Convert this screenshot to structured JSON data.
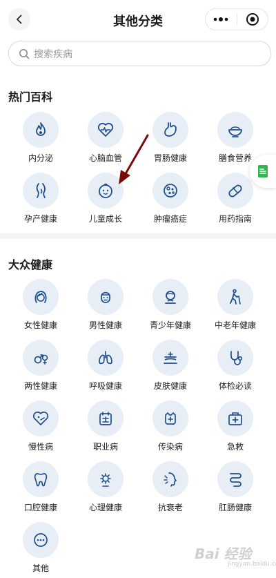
{
  "header": {
    "title": "其他分类",
    "back_icon": "chevron-left-icon",
    "more_icon": "more-dots-icon",
    "close_icon": "target-circle-icon"
  },
  "search": {
    "placeholder": "搜索疾病",
    "icon": "search-icon"
  },
  "sections": [
    {
      "title": "热门百科",
      "items": [
        {
          "label": "内分泌",
          "icon": "flame-icon"
        },
        {
          "label": "心脑血管",
          "icon": "heart-pulse-icon"
        },
        {
          "label": "胃肠健康",
          "icon": "stomach-icon"
        },
        {
          "label": "膳食营养",
          "icon": "bowl-icon"
        },
        {
          "label": "孕产健康",
          "icon": "pregnancy-icon"
        },
        {
          "label": "儿童成长",
          "icon": "baby-face-icon"
        },
        {
          "label": "肿瘤癌症",
          "icon": "tumor-cell-icon"
        },
        {
          "label": "用药指南",
          "icon": "pill-icon"
        }
      ]
    },
    {
      "title": "大众健康",
      "items": [
        {
          "label": "女性健康",
          "icon": "woman-icon"
        },
        {
          "label": "男性健康",
          "icon": "man-icon"
        },
        {
          "label": "青少年健康",
          "icon": "teen-icon"
        },
        {
          "label": "中老年健康",
          "icon": "elder-walking-icon"
        },
        {
          "label": "两性健康",
          "icon": "gender-icon"
        },
        {
          "label": "呼吸健康",
          "icon": "lungs-icon"
        },
        {
          "label": "皮肤健康",
          "icon": "skin-icon"
        },
        {
          "label": "体检必读",
          "icon": "stethoscope-icon"
        },
        {
          "label": "慢性病",
          "icon": "heart-tag-icon"
        },
        {
          "label": "职业病",
          "icon": "calendar-plus-icon"
        },
        {
          "label": "传染病",
          "icon": "virus-icon"
        },
        {
          "label": "急救",
          "icon": "first-aid-icon"
        },
        {
          "label": "口腔健康",
          "icon": "tooth-icon"
        },
        {
          "label": "心理健康",
          "icon": "brain-gear-icon"
        },
        {
          "label": "抗衰老",
          "icon": "face-profile-icon"
        },
        {
          "label": "肛肠健康",
          "icon": "intestine-icon"
        },
        {
          "label": "其他",
          "icon": "more-circle-icon"
        }
      ]
    }
  ],
  "floating_button": {
    "icon": "document-icon",
    "color": "#2db84d"
  },
  "watermark": {
    "text": "Bai 经验",
    "sub": "jingyan.baidu.com"
  },
  "colors": {
    "accent": "#1f4e8c",
    "icon_bg": "#e8eef6",
    "arrow": "#7a0a0a"
  }
}
